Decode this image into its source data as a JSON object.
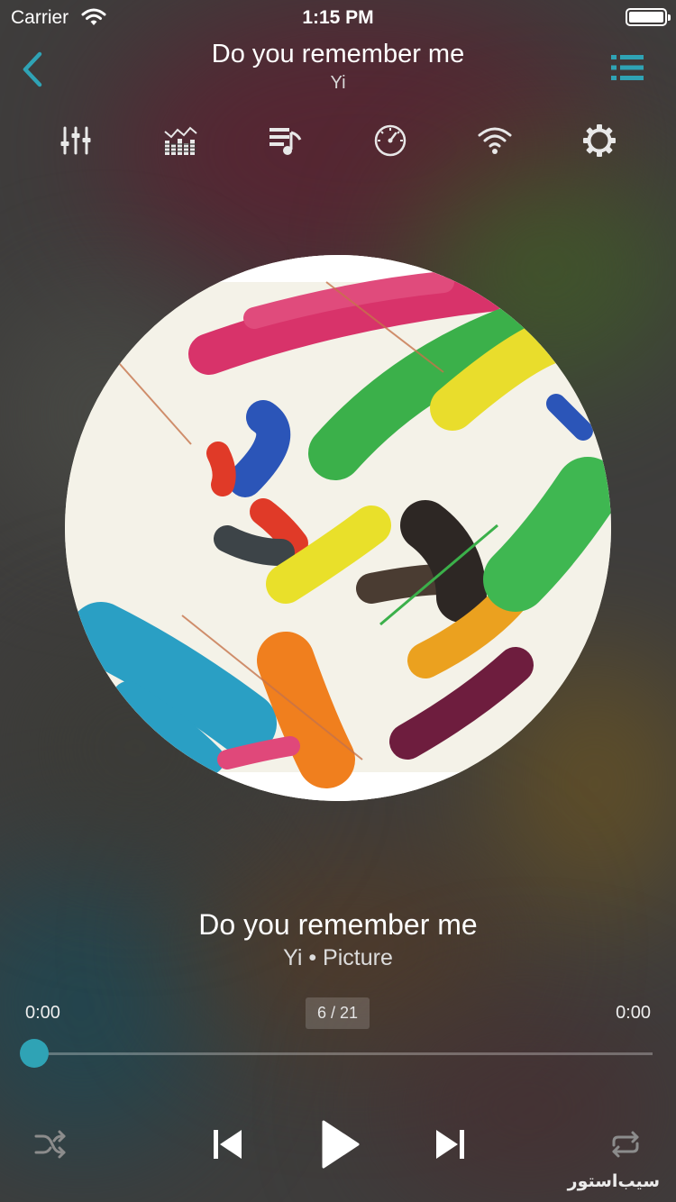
{
  "status_bar": {
    "carrier": "Carrier",
    "time": "1:15 PM"
  },
  "header": {
    "title": "Do you remember me",
    "artist": "Yi"
  },
  "toolbar": {
    "icons": [
      "equalizer-icon",
      "spectrum-icon",
      "lyrics-icon",
      "timer-icon",
      "wifi-share-icon",
      "settings-icon"
    ]
  },
  "song": {
    "title": "Do you remember me",
    "meta": "Yi • Picture"
  },
  "progress": {
    "elapsed": "0:00",
    "total": "0:00",
    "track_position": "6 / 21",
    "fraction": 0
  },
  "controls": [
    "shuffle-icon",
    "previous-icon",
    "play-icon",
    "next-icon",
    "repeat-icon"
  ],
  "watermark": "سیب‌استور",
  "colors": {
    "accent": "#2fa3b5",
    "text": "#ffffff",
    "background": "#3e3d3c"
  }
}
